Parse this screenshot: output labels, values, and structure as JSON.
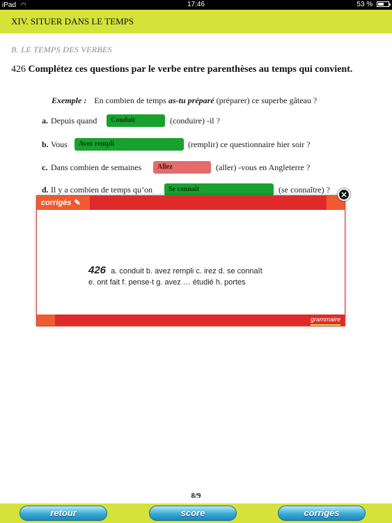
{
  "status_bar": {
    "device": "iPad",
    "time": "17:46",
    "battery": "53 %",
    "battery_level": 0.53
  },
  "header": {
    "chapter": "XIV. SITUER DANS LE TEMPS",
    "section": "B. LE TEMPS DES VERBES"
  },
  "exercise": {
    "number": "426",
    "instruction": "Complétez ces questions par le verbe entre parenthèses au temps qui convient."
  },
  "example": {
    "label": "Exemple :",
    "before": "En combien de temps",
    "verb": "as-tu préparé",
    "after": "(préparer) ce superbe gâteau ?"
  },
  "questions": [
    {
      "letter": "a.",
      "before": "Depuis quand",
      "answer": "Conduit",
      "status": "correct",
      "after": "(conduire) -il ?"
    },
    {
      "letter": "b.",
      "before": "Vous",
      "answer": "Avez rempli",
      "status": "correct",
      "after": "(remplir) ce questionnaire hier soir ?"
    },
    {
      "letter": "c.",
      "before": "Dans combien de semaines",
      "answer": "Allez",
      "status": "incorrect",
      "after": "(aller) -vous en Angleterre ?"
    },
    {
      "letter": "d.",
      "before": "Il y a combien de temps qu’on",
      "answer": "Se connaît",
      "status": "correct",
      "after": "(se connaître) ?"
    }
  ],
  "popup": {
    "tab_label": "corrigés",
    "exercise_number": "426",
    "line1": "a. conduit  b. avez rempli  c. irez  d. se connaît",
    "line2": "e. ont fait   f. pense-t   g. avez … étudié   h. portes",
    "brand": "grammaire",
    "close_icon": "close-icon"
  },
  "pager": "8/9",
  "bottom_bar": {
    "retour": "retour",
    "score": "score",
    "corriges": "corrigés"
  },
  "colors": {
    "accent": "#d5e23a",
    "popup_red": "#e02a2a",
    "correct": "#18a12e",
    "incorrect": "#e46b6b",
    "button_blue": "#38a9d6"
  }
}
